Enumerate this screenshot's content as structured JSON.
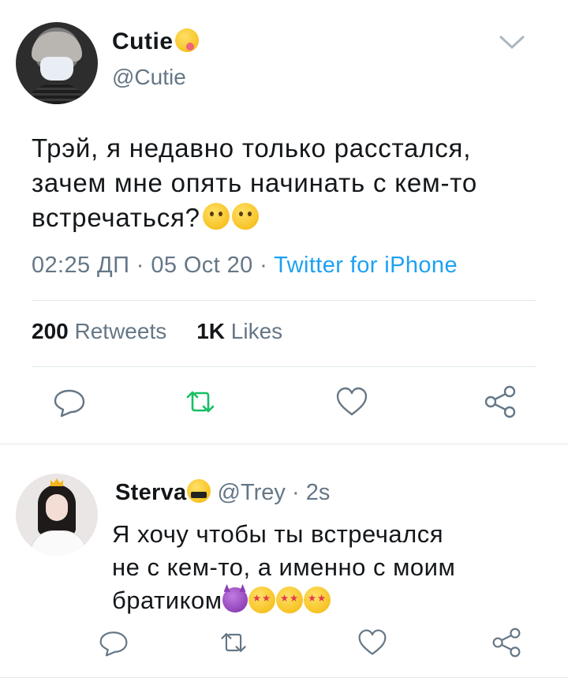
{
  "tweet": {
    "author_name": "Cutie",
    "author_emoji": "face-savoring-food-emoji",
    "handle": "@Cutie",
    "text_lines": [
      "Трэй, я недавно только расстался,",
      "зачем мне опять начинать с кем-то",
      "встречаться?"
    ],
    "text_emojis": [
      "face-with-raised-eyebrow-emoji",
      "confused-face-emoji"
    ],
    "time": "02:25 ДП",
    "date": "05 Oct 20",
    "source": "Twitter for iPhone",
    "retweets_count": "200",
    "retweets_label": "Retweets",
    "likes_count": "1K",
    "likes_label": "Likes",
    "actions": [
      "reply-icon",
      "retweet-icon",
      "like-icon",
      "share-icon"
    ],
    "retweet_active_color": "#17bf63"
  },
  "reply": {
    "author_name": "Sterva",
    "author_emoji": "face-with-symbols-on-mouth-emoji",
    "handle": "@Trey",
    "age": "2s",
    "text_lines": [
      "Я хочу чтобы ты встречался",
      "не с кем-то, а именно с моим",
      "братиком"
    ],
    "text_emojis": [
      "smiling-face-with-horns-emoji",
      "star-struck-emoji",
      "star-struck-emoji",
      "star-struck-emoji"
    ],
    "actions": [
      "reply-icon",
      "retweet-icon",
      "like-icon",
      "share-icon"
    ]
  },
  "colors": {
    "text": "#14171a",
    "secondary": "#657786",
    "link": "#1da1f2",
    "divider": "#e1e8ed"
  }
}
